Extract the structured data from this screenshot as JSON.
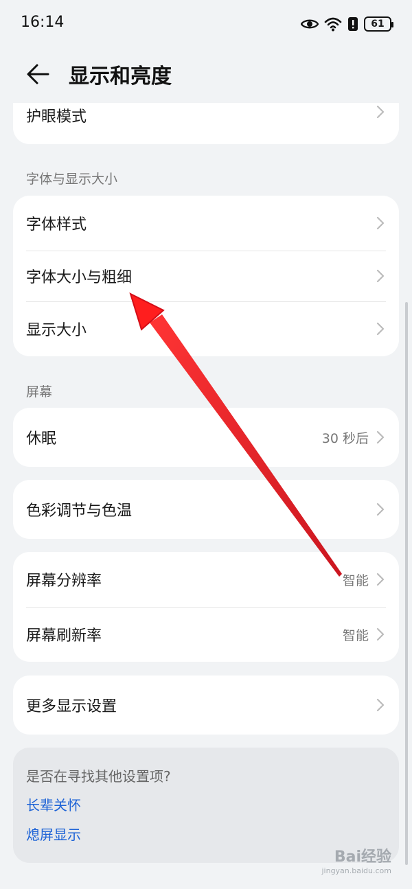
{
  "status_bar": {
    "time": "16:14",
    "battery": "61"
  },
  "header": {
    "title": "显示和亮度"
  },
  "eye_care": {
    "label": "护眼模式"
  },
  "font_section": {
    "title": "字体与显示大小",
    "items": [
      {
        "label": "字体样式"
      },
      {
        "label": "字体大小与粗细"
      },
      {
        "label": "显示大小"
      }
    ]
  },
  "screen_section": {
    "title": "屏幕",
    "sleep": {
      "label": "休眠",
      "value": "30 秒后"
    },
    "color": {
      "label": "色彩调节与色温"
    },
    "resolution": {
      "label": "屏幕分辨率",
      "value": "智能"
    },
    "refresh": {
      "label": "屏幕刷新率",
      "value": "智能"
    },
    "more": {
      "label": "更多显示设置"
    }
  },
  "search_card": {
    "prompt": "是否在寻找其他设置项?",
    "links": [
      "长辈关怀",
      "熄屏显示"
    ]
  },
  "watermark": {
    "text": "Bai经验",
    "sub": "jingyan.baidu.com"
  },
  "colors": {
    "accent": "#1e63d6",
    "arrow": "#e0141e",
    "background": "#f1f3f5"
  }
}
